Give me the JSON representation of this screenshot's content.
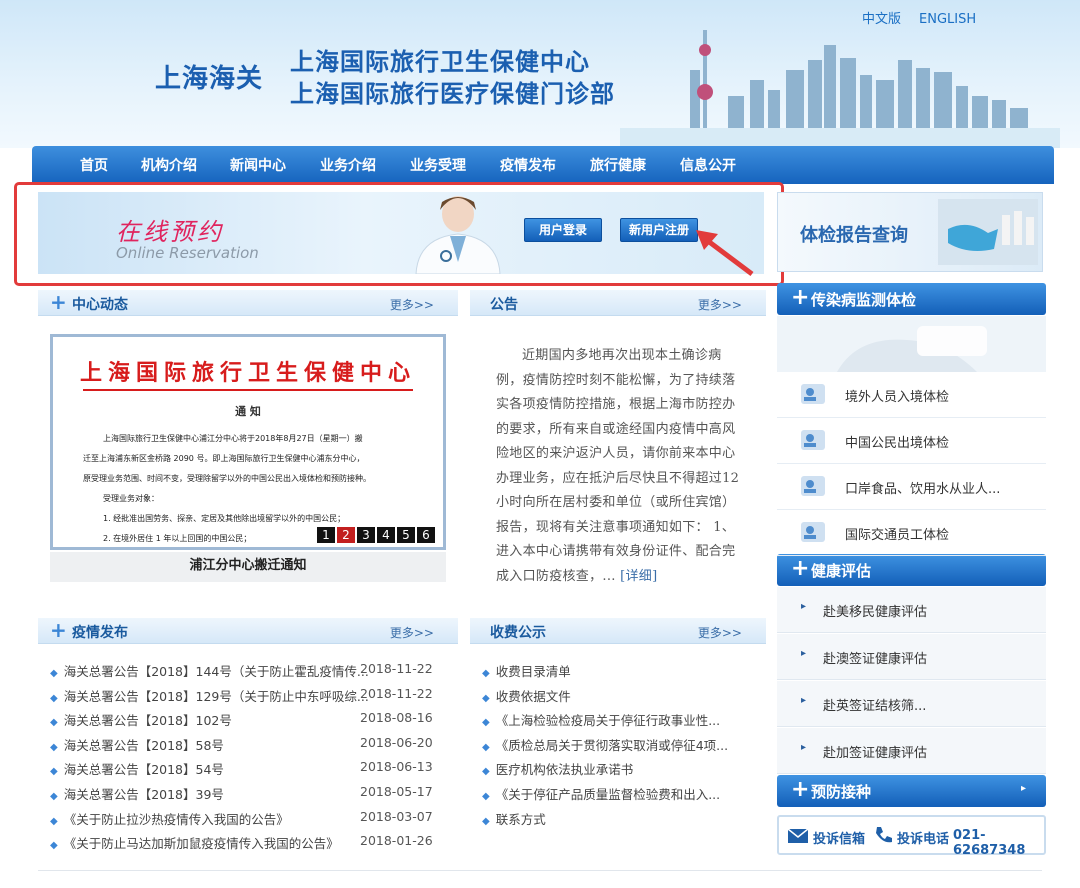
{
  "header": {
    "lang": {
      "zh": "中文版",
      "en": "ENGLISH"
    },
    "org": "上海海关",
    "title1": "上海国际旅行卫生保健中心",
    "title2": "上海国际旅行医疗保健门诊部"
  },
  "nav": [
    "首页",
    "机构介绍",
    "新闻中心",
    "业务介绍",
    "业务受理",
    "疫情发布",
    "旅行健康",
    "信息公开"
  ],
  "banner": {
    "title": "在线预约",
    "subtitle": "Online Reservation",
    "login": "用户登录",
    "register": "新用户注册"
  },
  "report": {
    "label": "体检报告查询"
  },
  "news": {
    "title": "中心动态",
    "more": "更多>>",
    "notice_title": "上海国际旅行卫生保健中心",
    "notice_sub": "通  知",
    "lines": [
      "上海国际旅行卫生保健中心浦江分中心将于2018年8月27日（星期一）搬",
      "迁至上海浦东新区金桥路 2090 号。即上海国际旅行卫生保健中心浦东分中心，",
      "原受理业务范围、时间不变，受理除留学以外的中国公民出入境体检和预防接种。",
      "受理业务对象：",
      "1. 经批准出国劳务、探亲、定居及其他除出境留学以外的中国公民；",
      "2. 在境外居住 1 年以上回国的中国公民；"
    ],
    "pages": [
      "1",
      "2",
      "3",
      "4",
      "5",
      "6"
    ],
    "caption": "浦江分中心搬迁通知"
  },
  "announce": {
    "title": "公告",
    "more": "更多>>",
    "body": "近期国内多地再次出现本土确诊病例，疫情防控时刻不能松懈，为了持续落实各项疫情防控措施，根据上海市防控办的要求，所有来自或途经国内疫情中高风险地区的来沪返沪人员，请你前来本中心办理业务，应在抵沪后尽快且不得超过12小时向所在居村委和单位（或所住宾馆）报告，现将有关注意事项通知如下：  1、进入本中心请携带有效身份证件、配合完成入口防疫核查，...",
    "detail": "[详细]"
  },
  "epidemic": {
    "title": "疫情发布",
    "more": "更多>>",
    "items": [
      {
        "t": "海关总署公告【2018】144号（关于防止霍乱疫情传...",
        "d": "2018-11-22"
      },
      {
        "t": "海关总署公告【2018】129号（关于防止中东呼吸综...",
        "d": "2018-11-22"
      },
      {
        "t": "海关总署公告【2018】102号",
        "d": "2018-08-16"
      },
      {
        "t": "海关总署公告【2018】58号",
        "d": "2018-06-20"
      },
      {
        "t": "海关总署公告【2018】54号",
        "d": "2018-06-13"
      },
      {
        "t": "海关总署公告【2018】39号",
        "d": "2018-05-17"
      },
      {
        "t": "《关于防止拉沙热疫情传入我国的公告》",
        "d": "2018-03-07"
      },
      {
        "t": "《关于防止马达加斯加鼠疫疫情传入我国的公告》",
        "d": "2018-01-26"
      }
    ]
  },
  "fees": {
    "title": "收费公示",
    "more": "更多>>",
    "items": [
      "收费目录清单",
      "收费依据文件",
      "《上海检验检疫局关于停征行政事业性...",
      "《质检总局关于贯彻落实取消或停征4项...",
      "医疗机构依法执业承诺书",
      "《关于停征产品质量监督检验费和出入...",
      "联系方式"
    ]
  },
  "side": {
    "h1": "传染病监测体检",
    "items1": [
      "境外人员入境体检",
      "中国公民出境体检",
      "口岸食品、饮用水从业人...",
      "国际交通员工体检"
    ],
    "h2": "健康评估",
    "items2": [
      "赴美移民健康评估",
      "赴澳签证健康评估",
      "赴英签证结核筛...",
      "赴加签证健康评估"
    ],
    "h3": "预防接种",
    "c1": "投诉信箱",
    "c2": "投诉电话",
    "phone": "021-62687348"
  }
}
